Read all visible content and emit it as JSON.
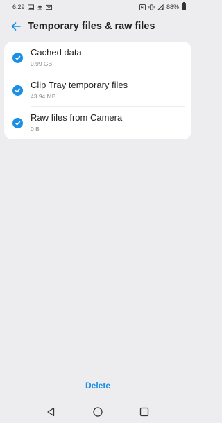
{
  "status_bar": {
    "time": "6:29",
    "battery": "88%",
    "left_icons": [
      "image-icon",
      "upload-icon",
      "mail-icon"
    ],
    "right_icons": [
      "nfc-icon",
      "vibrate-icon",
      "signal-icon"
    ]
  },
  "header": {
    "title": "Temporary files & raw files",
    "back_icon": "arrow-left-icon"
  },
  "items": [
    {
      "title": "Cached data",
      "size": "0.99 GB",
      "checked": true
    },
    {
      "title": "Clip Tray temporary files",
      "size": "43.94 MB",
      "checked": true
    },
    {
      "title": "Raw files from Camera",
      "size": "0 B",
      "checked": true
    }
  ],
  "actions": {
    "delete_label": "Delete"
  },
  "nav": {
    "icons": [
      "back-triangle-icon",
      "home-circle-icon",
      "recents-square-icon"
    ]
  },
  "colors": {
    "accent": "#1a8fe3",
    "background": "#ededf0",
    "card": "#ffffff"
  }
}
